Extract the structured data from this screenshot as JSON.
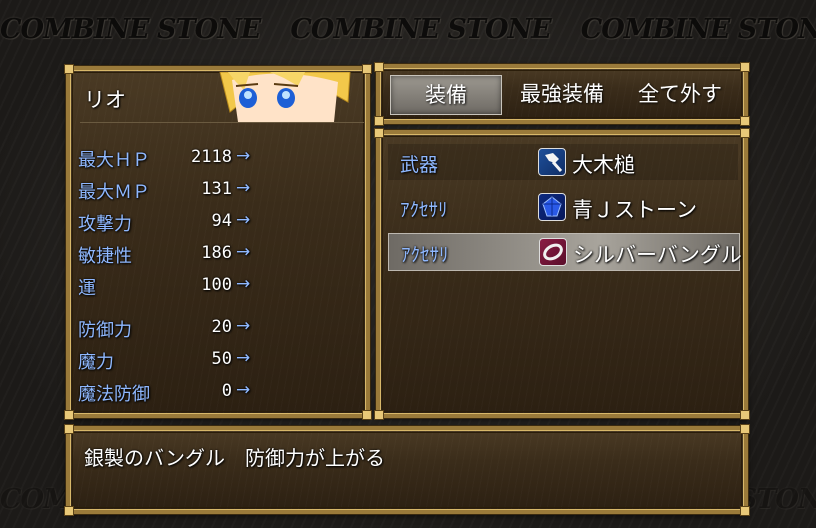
{
  "banner": {
    "text": "COMBINE STONE"
  },
  "actor": {
    "name": "リオ",
    "stats_main": [
      {
        "label": "最大ＨＰ",
        "value": "2118",
        "arrow": "→"
      },
      {
        "label": "最大ＭＰ",
        "value": "131",
        "arrow": "→"
      },
      {
        "label": "攻撃力",
        "value": "94",
        "arrow": "→"
      },
      {
        "label": "敏捷性",
        "value": "186",
        "arrow": "→"
      },
      {
        "label": "運",
        "value": "100",
        "arrow": "→"
      }
    ],
    "stats_def": [
      {
        "label": "防御力",
        "value": "20",
        "arrow": "→"
      },
      {
        "label": "魔力",
        "value": "50",
        "arrow": "→"
      },
      {
        "label": "魔法防御",
        "value": "0",
        "arrow": "→"
      }
    ]
  },
  "commands": [
    {
      "label": "装備",
      "selected": true
    },
    {
      "label": "最強装備",
      "selected": false
    },
    {
      "label": "全て外す",
      "selected": false
    }
  ],
  "slots": [
    {
      "type": "武器",
      "item": "大木槌",
      "icon": "hammer-icon"
    },
    {
      "type": "ｱｸｾｻﾘ",
      "item": "青Ｊストーン",
      "icon": "blue-gem-icon"
    },
    {
      "type": "ｱｸｾｻﾘ",
      "item": "シルバーバングル",
      "icon": "bangle-icon"
    }
  ],
  "help": {
    "text": "銀製のバングル　防御力が上がる"
  },
  "colors": {
    "system_blue": "#8fb8ff",
    "frame_gold": "#9a7a3a"
  }
}
